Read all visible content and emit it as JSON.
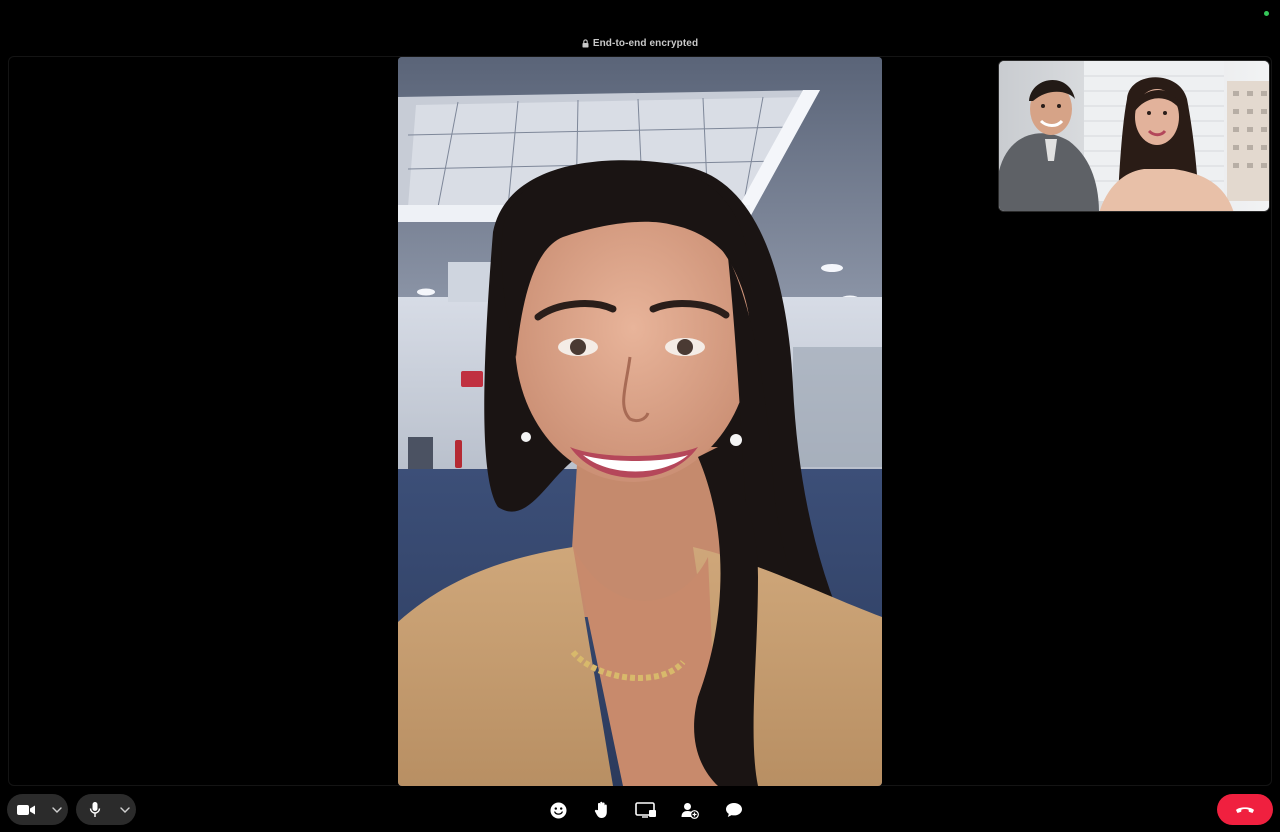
{
  "call": {
    "encryption_label": "End-to-end encrypted"
  },
  "colors": {
    "background": "#000000",
    "control_pill": "#2b2b2b",
    "end_call": "#f0203f",
    "status_indicator": "#34c759",
    "icon": "#ffffff"
  },
  "controls": {
    "left": [
      {
        "name": "video-toggle",
        "icon": "video-camera-icon",
        "has_dropdown": true
      },
      {
        "name": "microphone-toggle",
        "icon": "microphone-icon",
        "has_dropdown": true
      }
    ],
    "center": [
      {
        "name": "reactions",
        "icon": "smiley-icon"
      },
      {
        "name": "raise-hand",
        "icon": "hand-icon"
      },
      {
        "name": "share-screen",
        "icon": "screen-share-icon"
      },
      {
        "name": "add-participant",
        "icon": "person-add-icon"
      },
      {
        "name": "chat",
        "icon": "chat-bubble-icon"
      }
    ],
    "right": [
      {
        "name": "end-call",
        "icon": "phone-hangup-icon"
      }
    ]
  },
  "videos": {
    "main": {
      "description_icon": "remote-participant-video"
    },
    "thumbnail": {
      "description_icon": "self-view-video"
    }
  }
}
